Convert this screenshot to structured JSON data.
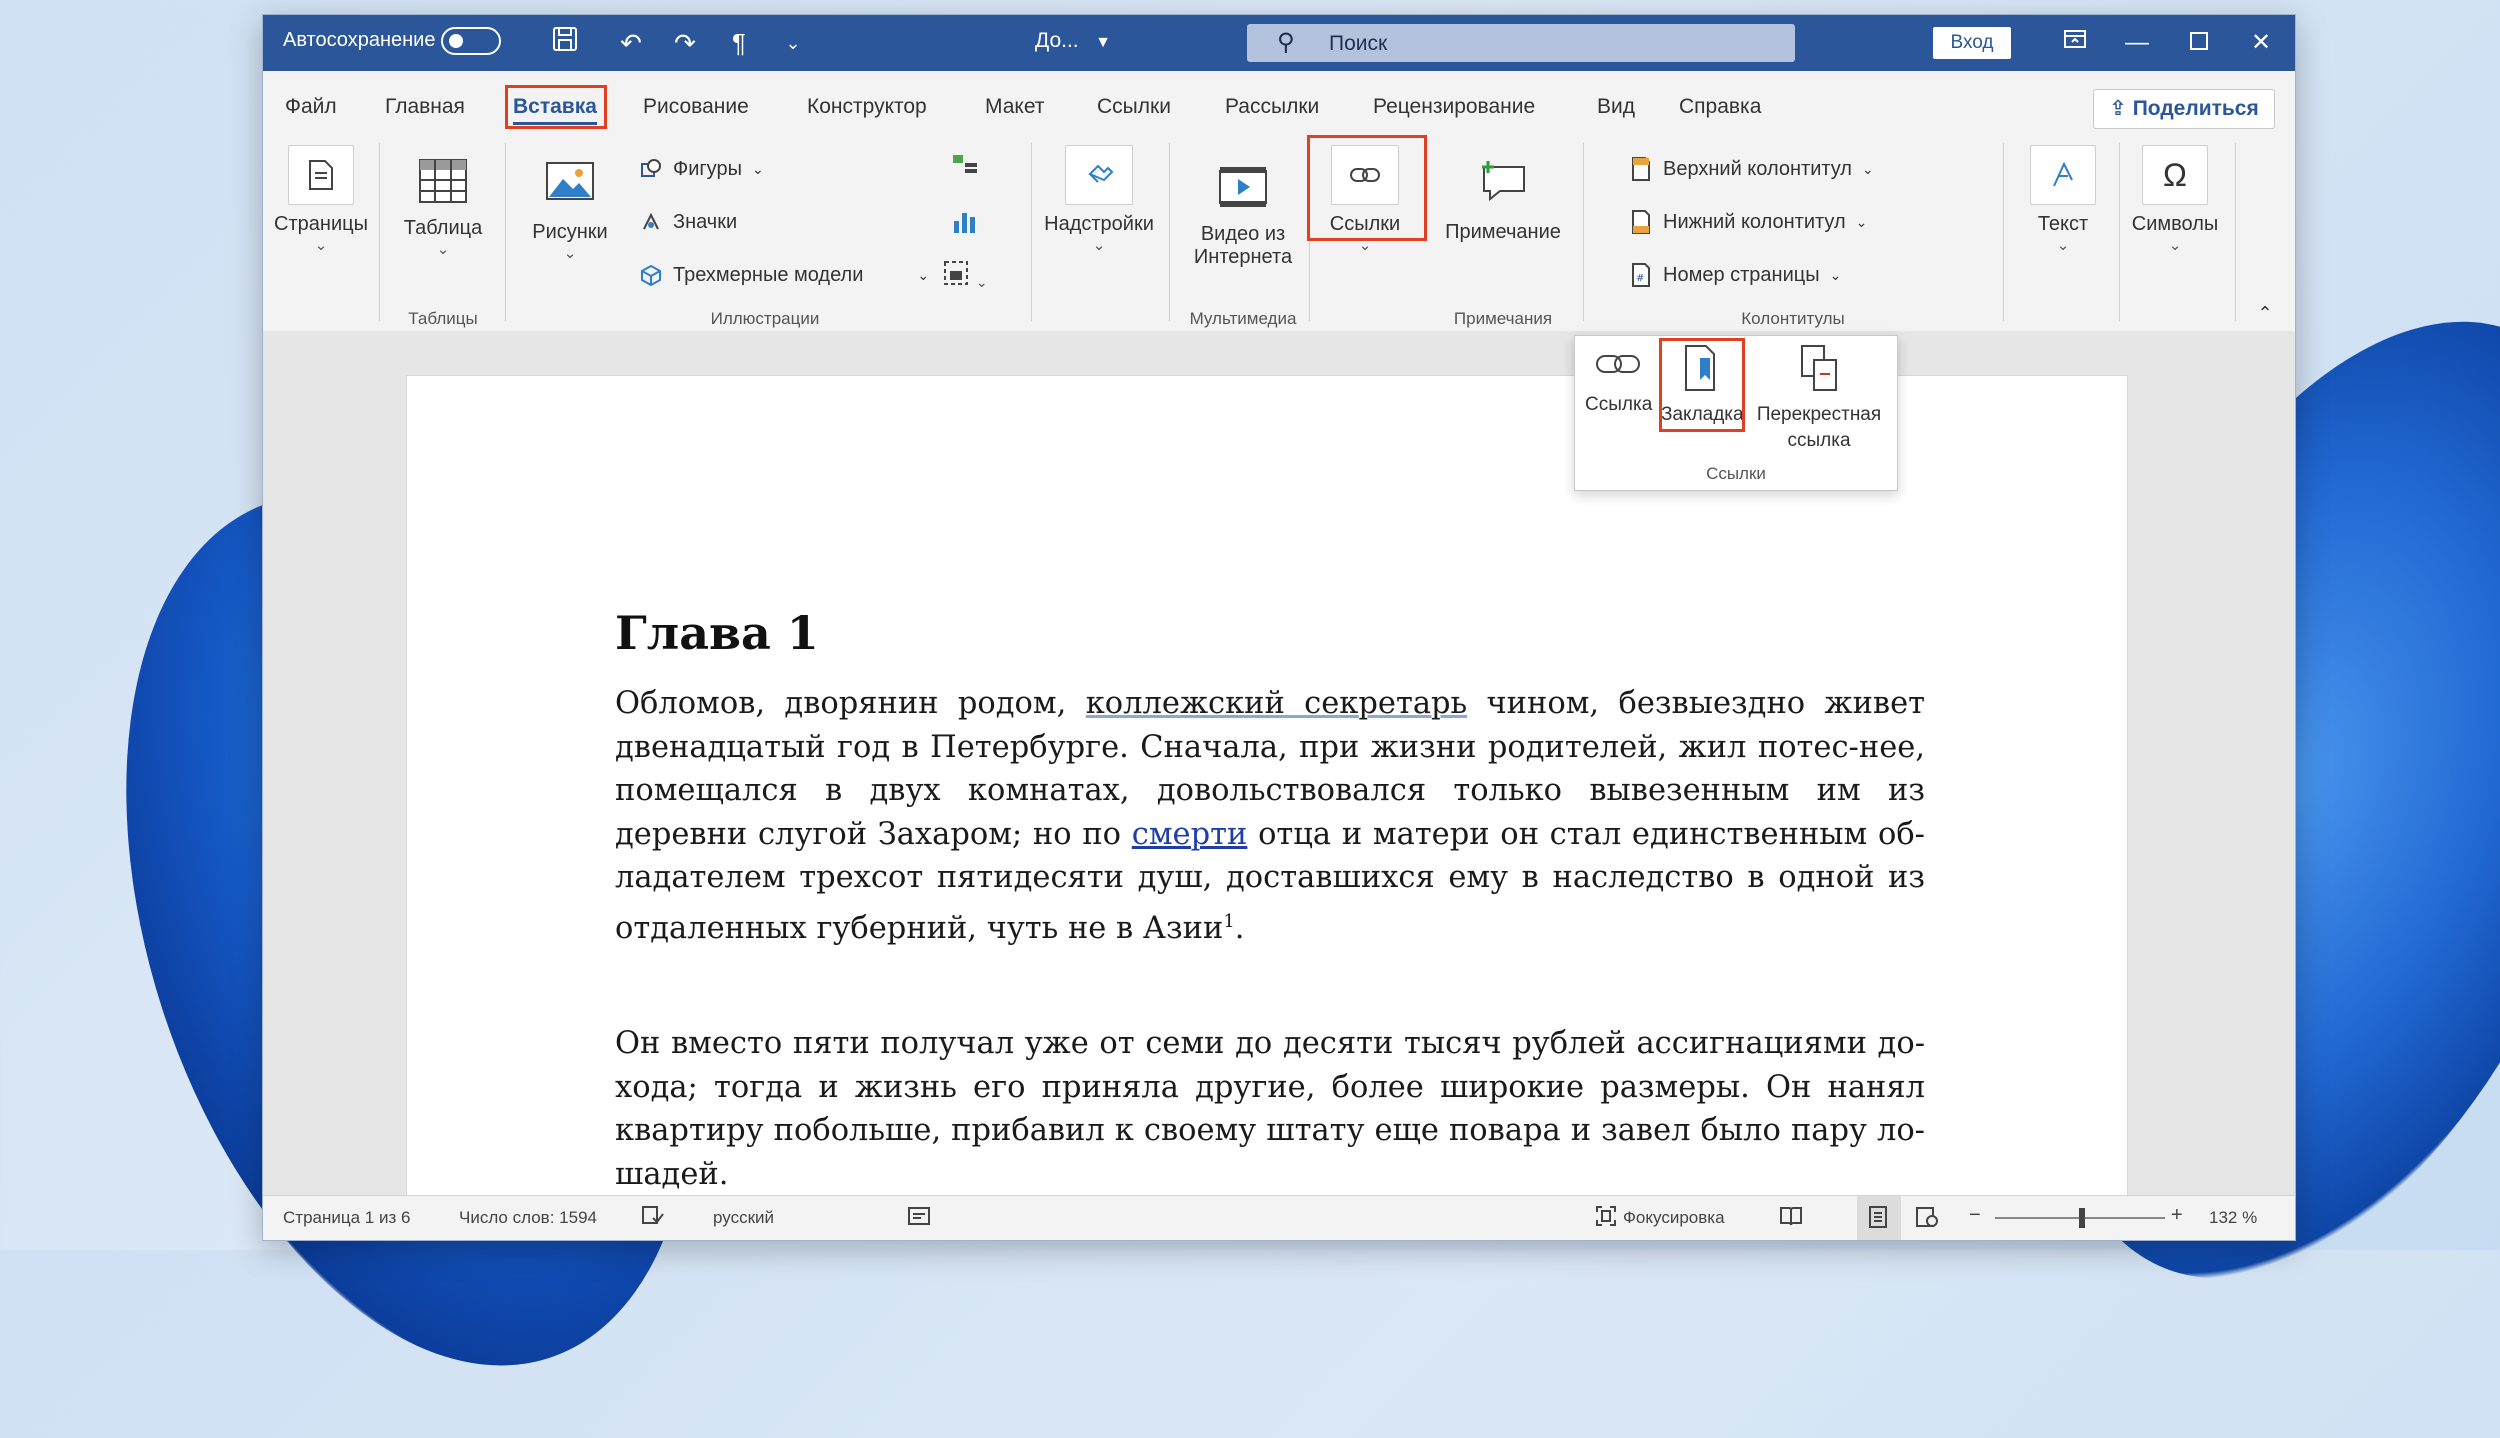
{
  "title_bar": {
    "autosave_label": "Автосохранение",
    "doc_name": "До...",
    "search_placeholder": "Поиск",
    "login_label": "Вход"
  },
  "tabs": [
    {
      "label": "Файл"
    },
    {
      "label": "Главная"
    },
    {
      "label": "Вставка",
      "active": true
    },
    {
      "label": "Рисование"
    },
    {
      "label": "Конструктор"
    },
    {
      "label": "Макет"
    },
    {
      "label": "Ссылки"
    },
    {
      "label": "Рассылки"
    },
    {
      "label": "Рецензирование"
    },
    {
      "label": "Вид"
    },
    {
      "label": "Справка"
    }
  ],
  "share_label": "Поделиться",
  "ribbon": {
    "pages": "Страницы",
    "table": "Таблица",
    "tables_group": "Таблицы",
    "pictures": "Рисунки",
    "shapes": "Фигуры",
    "icons": "Значки",
    "models_3d": "Трехмерные модели",
    "illustrations_group": "Иллюстрации",
    "addins": "Надстройки",
    "online_video_line1": "Видео из",
    "online_video_line2": "Интернета",
    "media_group": "Мультимедиа",
    "links": "Ссылки",
    "comment": "Примечание",
    "comments_group": "Примечания",
    "header": "Верхний колонтитул",
    "footer": "Нижний колонтитул",
    "page_number": "Номер страницы",
    "header_footer_group": "Колонтитулы",
    "text": "Текст",
    "symbols": "Символы"
  },
  "links_dropdown": {
    "link": "Ссылка",
    "bookmark": "Закладка",
    "cross_ref_line1": "Перекрестная",
    "cross_ref_line2": "ссылка",
    "group_label": "Ссылки"
  },
  "document": {
    "heading": "Глава 1",
    "p1": {
      "t1": "Обломов, дворянин родом, ",
      "u1": "коллежский  секретарь",
      "t2": " чином, безвыездно живет двенадцатый  год в Петербурге.  Сначала,  при  жизни  родителей,  жил  потес-нее,  помещался  в   двух   комнатах, довольствовался только вывезенным им из деревни слугой Захаром; но по ",
      "link": "смерти",
      "t3": " отца и матери он стал единственным об-ладателем трехсот пятидесяти душ, доставшихся ему в наследство в одной из отдаленных губерний, чуть не в Азии",
      "sup": "1",
      "t4": "."
    },
    "p2": "Он вместо пяти получал уже от семи до десяти тысяч рублей ассигнациями до-хода; тогда и жизнь его приняла другие, более широкие размеры. Он нанял квартиру побольше, прибавил к своему штату еще повара и завел было пару ло-шадей."
  },
  "status_bar": {
    "page_info": "Страница 1 из 6",
    "word_count": "Число слов: 1594",
    "language": "русский",
    "focus": "Фокусировка",
    "zoom": "132 %"
  }
}
